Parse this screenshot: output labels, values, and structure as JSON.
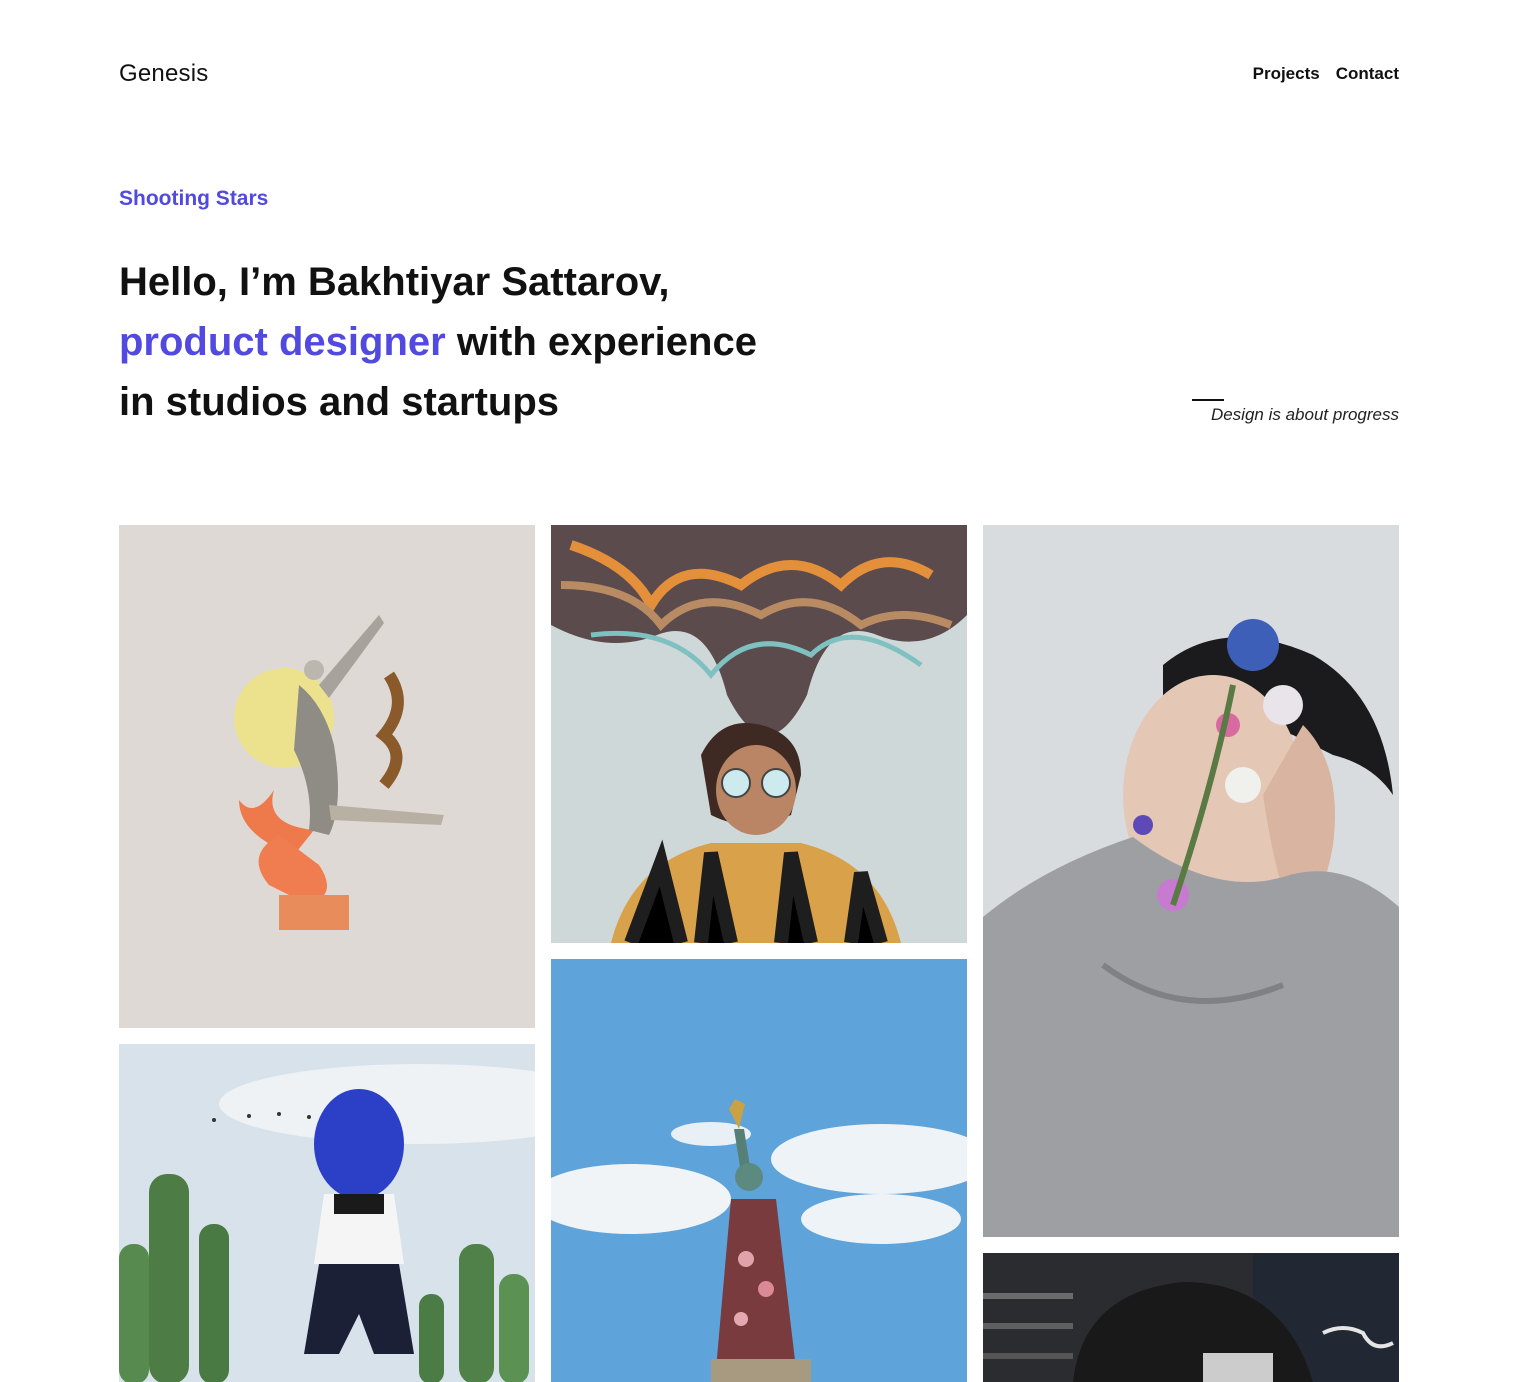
{
  "header": {
    "logo": "Genesis",
    "nav": [
      {
        "label": "Projects"
      },
      {
        "label": "Contact"
      }
    ]
  },
  "hero": {
    "eyebrow": "Shooting Stars",
    "headline_line1": "Hello, I’m Bakhtiyar Sattarov,",
    "headline_accent": "product designer",
    "headline_line2_rest": " with experience",
    "headline_line3": "in studios and startups",
    "tagline": "Design is about progress"
  },
  "colors": {
    "accent": "#5149e0",
    "text": "#111111",
    "background": "#ffffff"
  },
  "gallery": [
    {
      "subject": "collage-dancer"
    },
    {
      "subject": "surreal-smoke-head-portrait"
    },
    {
      "subject": "flower-face-portrait"
    },
    {
      "subject": "blue-balloon-cactus"
    },
    {
      "subject": "statue-of-liberty-floral"
    },
    {
      "subject": "partial-portrait-dark"
    }
  ]
}
